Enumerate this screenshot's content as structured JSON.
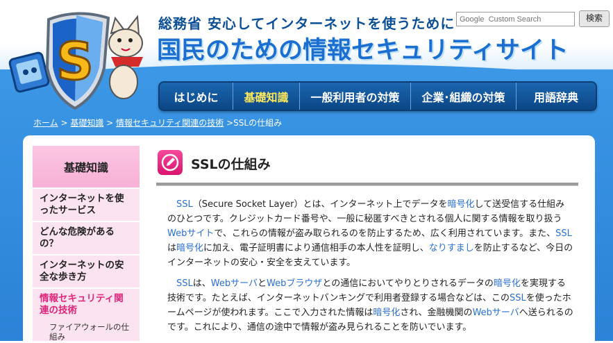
{
  "header": {
    "subtitle": "総務省 安心してインターネットを使うために",
    "title": "国民のための情報セキュリティサイト",
    "logo_letter": "S"
  },
  "search": {
    "placeholder": "Google  Custom Search",
    "button_label": "検索"
  },
  "nav": {
    "items": [
      {
        "label": "はじめに"
      },
      {
        "label": "基礎知識"
      },
      {
        "label": "一般利用者の対策"
      },
      {
        "label": "企業･組織の対策"
      },
      {
        "label": "用語辞典"
      }
    ]
  },
  "breadcrumb": {
    "home": "ホーム",
    "sep1": " > ",
    "basics": "基礎知識",
    "sep2": " > ",
    "tech": "情報セキュリティ関連の技術",
    "current": " >SSLの仕組み"
  },
  "sidebar": {
    "heading": "基礎知識",
    "items": [
      {
        "label": "インターネットを使ったサービス"
      },
      {
        "label": "どんな危険があるの？"
      },
      {
        "label": "インターネットの安全な歩き方"
      },
      {
        "label": "情報セキュリティ関連の技術"
      }
    ],
    "sub_items": [
      {
        "label": "ファイアウォールの仕組み"
      }
    ]
  },
  "article": {
    "title": "SSLの仕組み",
    "p1": [
      {
        "t": "SSL",
        "link": true
      },
      {
        "t": "（Secure Socket Layer）とは、インターネット上でデータを",
        "link": false
      },
      {
        "t": "暗号化",
        "link": true
      },
      {
        "t": "して送受信する仕組みのひとつです。クレジットカード番号や、一般に秘匿すべきとされる個人に関する情報を取り扱う",
        "link": false
      },
      {
        "t": "Webサイト",
        "link": true
      },
      {
        "t": "で、これらの情報が盗み取られるのを防止するため、広く利用されています。また、",
        "link": false
      },
      {
        "t": "SSL",
        "link": true
      },
      {
        "t": "は",
        "link": false
      },
      {
        "t": "暗号化",
        "link": true
      },
      {
        "t": "に加え、電子証明書により通信相手の本人性を証明し、",
        "link": false
      },
      {
        "t": "なりすまし",
        "link": true
      },
      {
        "t": "を防止するなど、今日のインターネットの安心・安全を支えています。",
        "link": false
      }
    ],
    "p2": [
      {
        "t": "SSL",
        "link": true
      },
      {
        "t": "は、",
        "link": false
      },
      {
        "t": "Webサーバ",
        "link": true
      },
      {
        "t": "と",
        "link": false
      },
      {
        "t": "Webブラウザ",
        "link": true
      },
      {
        "t": "との通信においてやりとりされるデータの",
        "link": false
      },
      {
        "t": "暗号化",
        "link": true
      },
      {
        "t": "を実現する技術です。たとえば、インターネットバンキングで利用者登録する場合などは、この",
        "link": false
      },
      {
        "t": "SSL",
        "link": true
      },
      {
        "t": "を使ったホームページが使われます。ここで入力された情報は",
        "link": false
      },
      {
        "t": "暗号化",
        "link": true
      },
      {
        "t": "され、金融機関の",
        "link": false
      },
      {
        "t": "Webサーバ",
        "link": true
      },
      {
        "t": "へ送られるのです。これにより、通信の途中で情報が盗み見られることを防いでいます。",
        "link": false
      }
    ]
  },
  "colors": {
    "accent_pink": "#e0257a",
    "link_blue": "#2a6fd0",
    "nav_blue": "#0b4685",
    "bg_blue": "#3c97e6"
  }
}
